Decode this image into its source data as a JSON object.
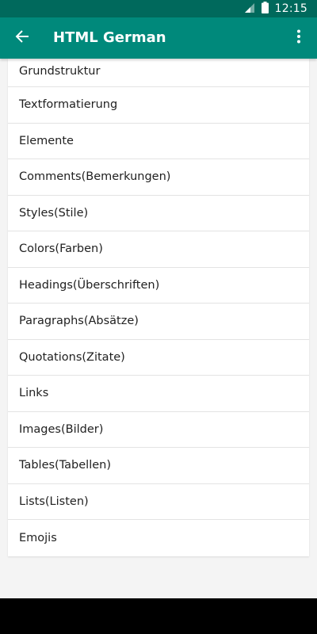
{
  "status_bar": {
    "time": "12:15",
    "icons": [
      "signal-icon",
      "battery-icon"
    ]
  },
  "app_bar": {
    "title": "HTML German",
    "back_icon": "back-arrow-icon",
    "menu_icon": "more-vert-icon"
  },
  "colors": {
    "status_bar": "#00695c",
    "app_bar": "#00897b",
    "background": "#f4f4f4",
    "list_bg": "#ffffff",
    "text": "#212121"
  },
  "list": {
    "items": [
      {
        "label": "Grundstruktur"
      },
      {
        "label": "Textformatierung"
      },
      {
        "label": "Elemente"
      },
      {
        "label": "Comments(Bemerkungen)"
      },
      {
        "label": "Styles(Stile)"
      },
      {
        "label": "Colors(Farben)"
      },
      {
        "label": "Headings(Überschriften)"
      },
      {
        "label": "Paragraphs(Absätze)"
      },
      {
        "label": "Quotations(Zitate)"
      },
      {
        "label": "Links"
      },
      {
        "label": "Images(Bilder)"
      },
      {
        "label": "Tables(Tabellen)"
      },
      {
        "label": "Lists(Listen)"
      },
      {
        "label": "Emojis"
      }
    ]
  }
}
